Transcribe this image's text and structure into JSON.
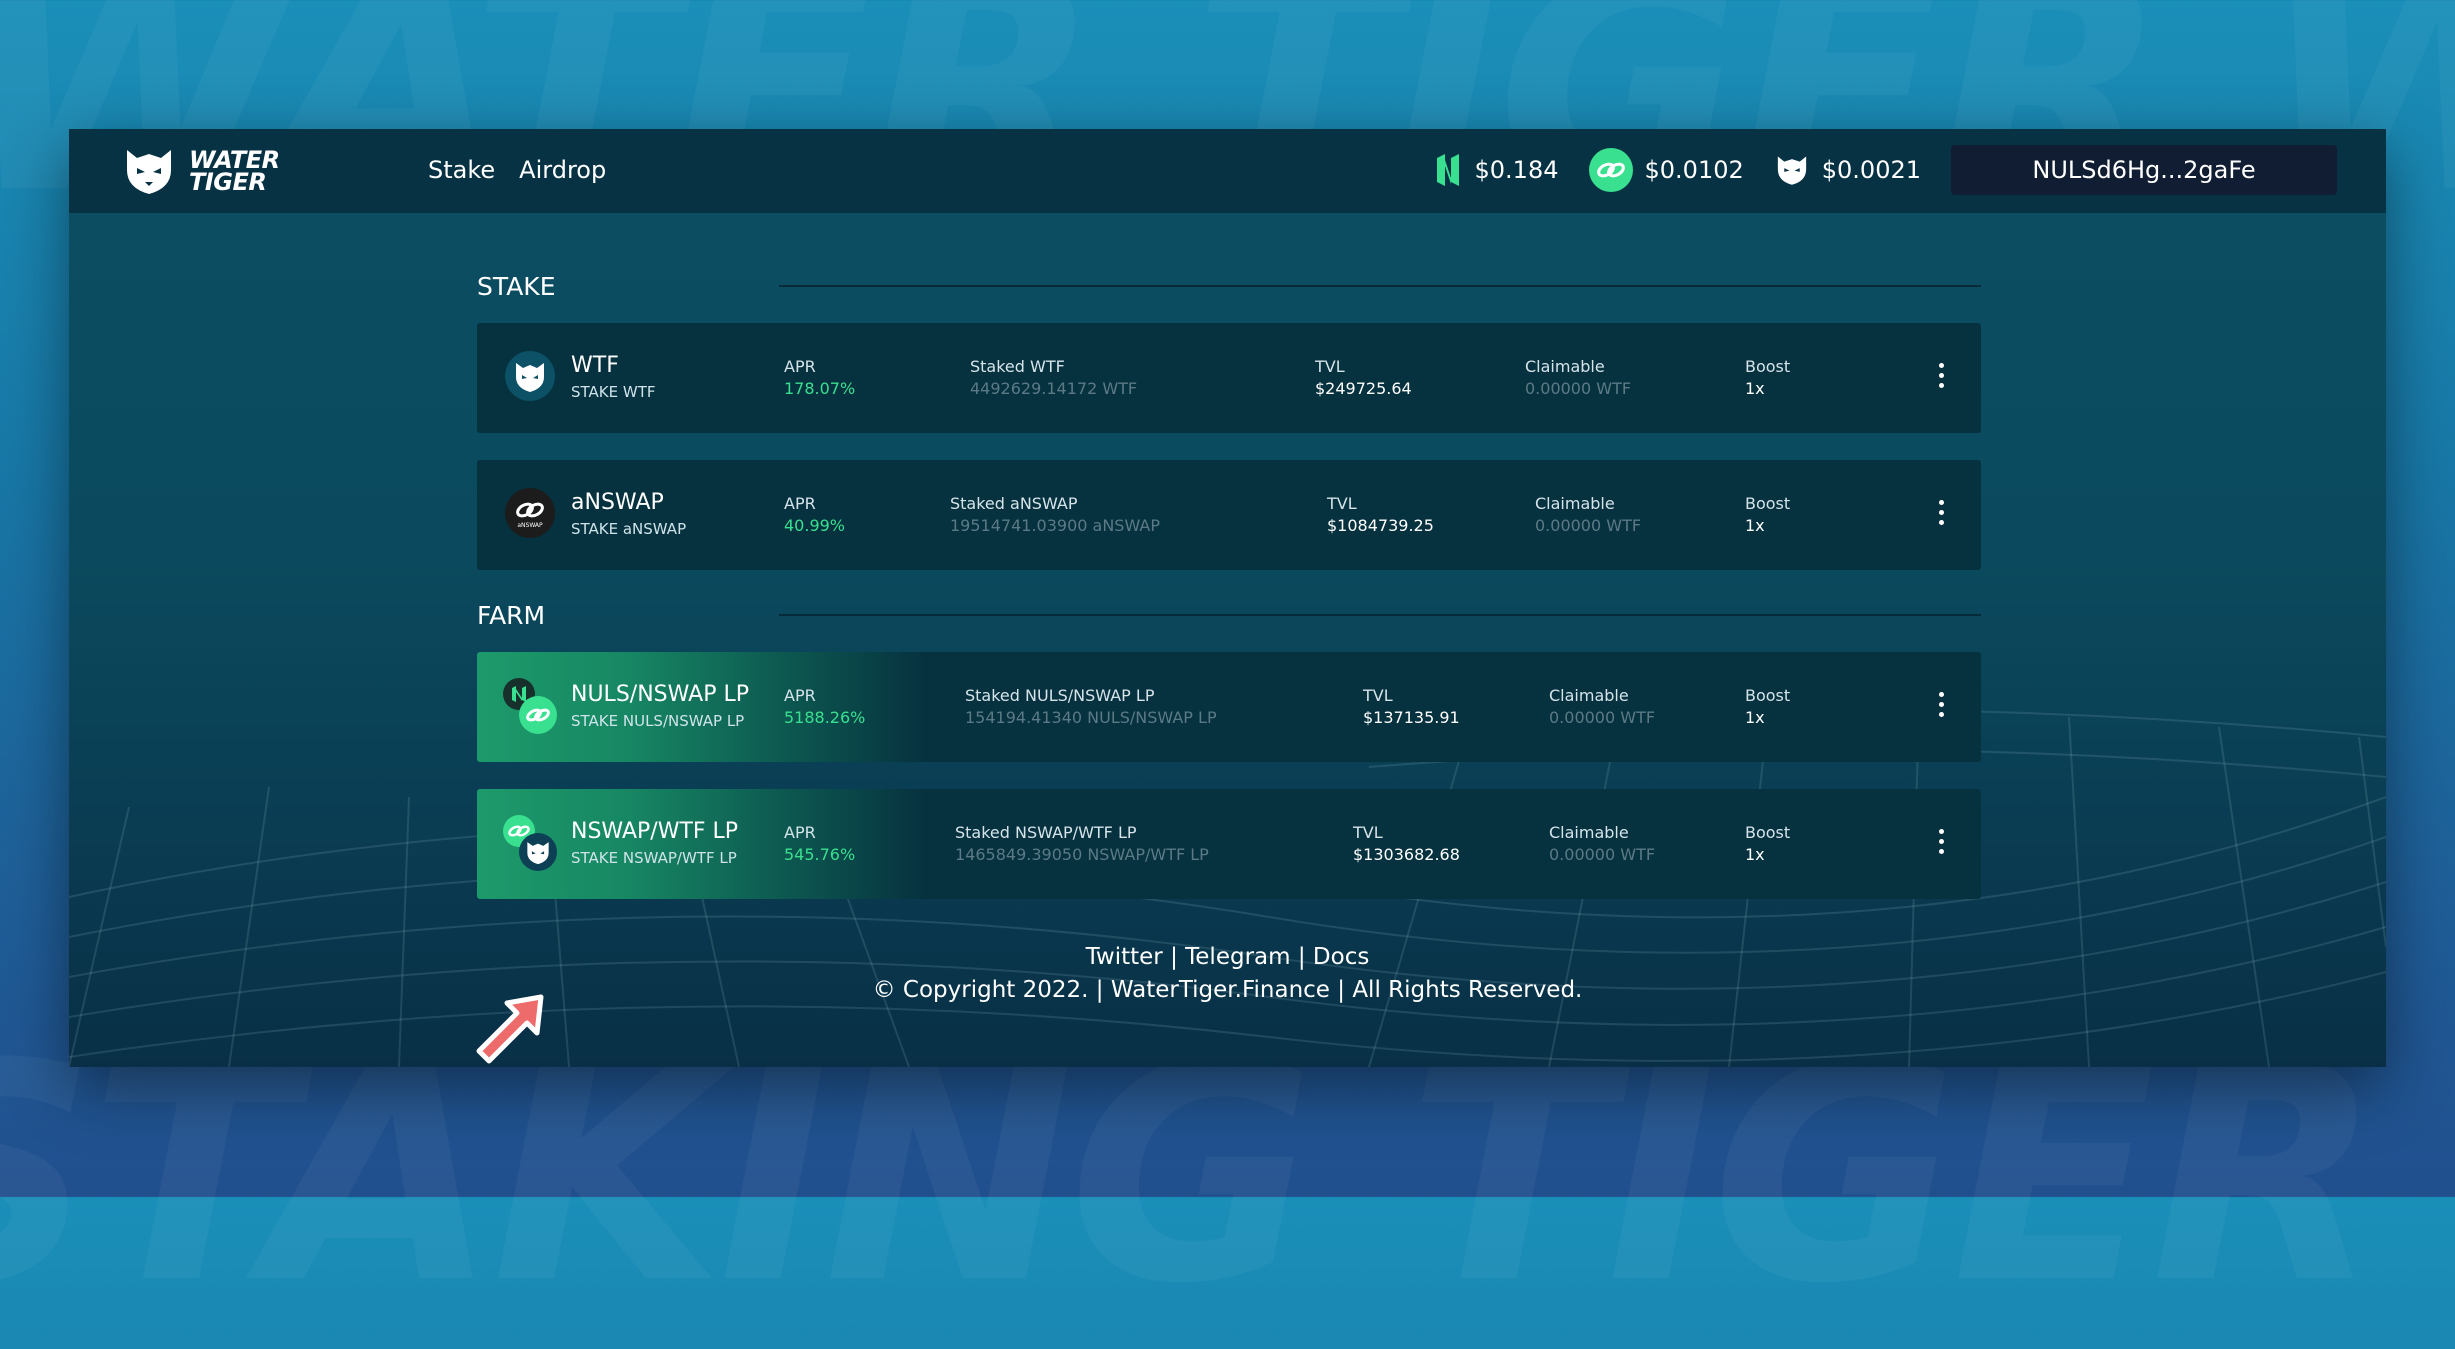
{
  "header": {
    "nav": [
      "Stake",
      "Airdrop"
    ],
    "prices": [
      {
        "icon": "nuls-icon",
        "value": "$0.184"
      },
      {
        "icon": "nswap-icon",
        "value": "$0.0102"
      },
      {
        "icon": "tiger-icon",
        "value": "$0.0021"
      }
    ],
    "wallet": "NULSd6Hg...2gaFe",
    "logo_line1": "WATER",
    "logo_line2": "TIGER"
  },
  "sections": {
    "stake": "STAKE",
    "farm": "FARM"
  },
  "labels": {
    "apr": "APR",
    "tvl": "TVL",
    "claimable": "Claimable",
    "boost": "Boost"
  },
  "pools": [
    {
      "name": "WTF",
      "sub": "STAKE WTF",
      "apr": "178.07%",
      "staked_label": "Staked WTF",
      "staked": "4492629.14172 WTF",
      "tvl": "$249725.64",
      "claimable": "0.00000 WTF",
      "boost": "1x"
    },
    {
      "name": "aNSWAP",
      "sub": "STAKE aNSWAP",
      "apr": "40.99%",
      "staked_label": "Staked aNSWAP",
      "staked": "19514741.03900 aNSWAP",
      "tvl": "$1084739.25",
      "claimable": "0.00000 WTF",
      "boost": "1x",
      "icon_text": "aNSWAP"
    },
    {
      "name": "NULS/NSWAP LP",
      "sub": "STAKE NULS/NSWAP LP",
      "apr": "5188.26%",
      "staked_label": "Staked NULS/NSWAP LP",
      "staked": "154194.41340 NULS/NSWAP LP",
      "tvl": "$137135.91",
      "claimable": "0.00000 WTF",
      "boost": "1x"
    },
    {
      "name": "NSWAP/WTF LP",
      "sub": "STAKE NSWAP/WTF LP",
      "apr": "545.76%",
      "staked_label": "Staked NSWAP/WTF LP",
      "staked": "1465849.39050 NSWAP/WTF LP",
      "tvl": "$1303682.68",
      "claimable": "0.00000 WTF",
      "boost": "1x"
    }
  ],
  "footer": {
    "links": [
      "Twitter",
      "Telegram",
      "Docs"
    ],
    "separator": "|",
    "copyright": "© Copyright 2022. | WaterTiger.Finance | All Rights Reserved."
  },
  "colors": {
    "accent_green": "#39e08f",
    "card_bg": "#06313f",
    "header_bg": "#063243",
    "wallet_bg": "#101d33"
  }
}
